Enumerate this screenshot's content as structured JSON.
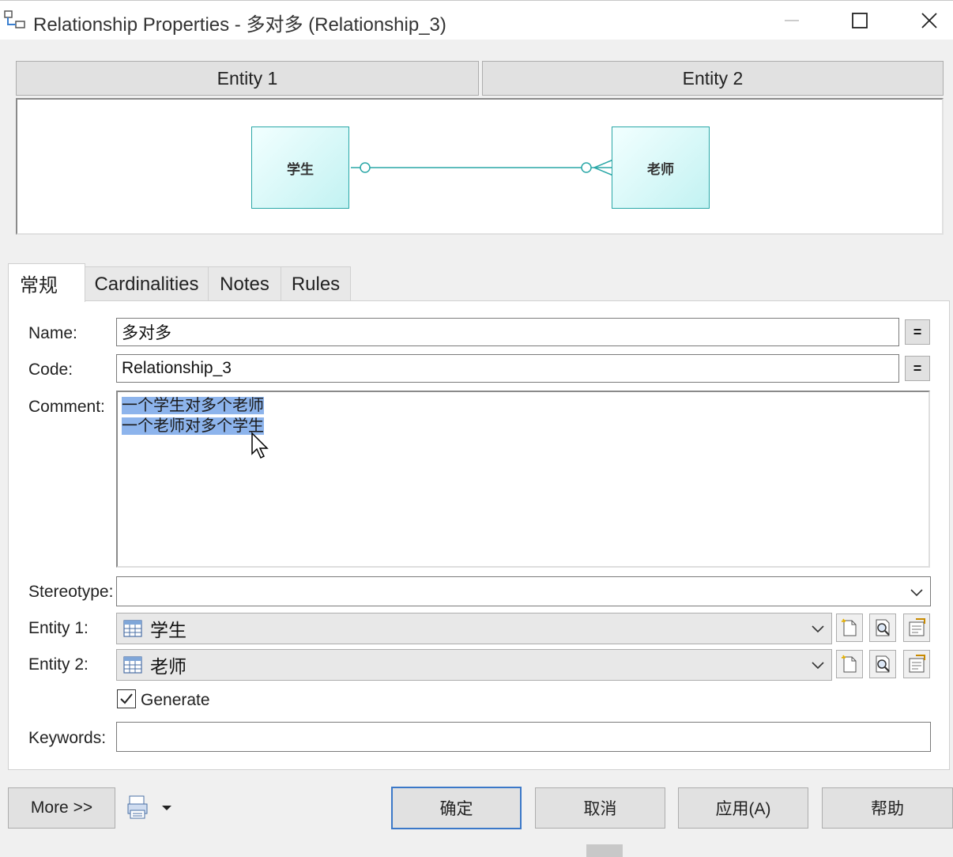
{
  "window": {
    "title": "Relationship Properties - 多对多 (Relationship_3)",
    "minimize_icon": "minimize-icon",
    "maximize_icon": "maximize-icon",
    "close_icon": "close-icon"
  },
  "entity_headers": {
    "entity1": "Entity 1",
    "entity2": "Entity 2"
  },
  "diagram": {
    "entity_left": "学生",
    "entity_right": "老师",
    "line_color": "#2aa7a7"
  },
  "tabs": [
    {
      "label": "常规",
      "active": true
    },
    {
      "label": "Cardinalities",
      "active": false
    },
    {
      "label": "Notes",
      "active": false
    },
    {
      "label": "Rules",
      "active": false
    }
  ],
  "form": {
    "name_label": "Name:",
    "name_value": "多对多",
    "code_label": "Code:",
    "code_value": "Relationship_3",
    "eq_label": "=",
    "comment_label": "Comment:",
    "comment_lines": [
      "一个学生对多个老师",
      "一个老师对多个学生"
    ],
    "stereotype_label": "Stereotype:",
    "stereotype_value": "",
    "entity1_label": "Entity 1:",
    "entity1_value": "学生",
    "entity2_label": "Entity 2:",
    "entity2_value": "老师",
    "generate_label": "Generate",
    "generate_checked": true,
    "keywords_label": "Keywords:",
    "keywords_value": ""
  },
  "buttons": {
    "more": "More >>",
    "ok": "确定",
    "cancel": "取消",
    "apply": "应用(A)",
    "help": "帮助"
  },
  "colors": {
    "selection": "#8db4ec",
    "default_button_border": "#3b78c8",
    "entity_fill": "#c2f2f2"
  }
}
